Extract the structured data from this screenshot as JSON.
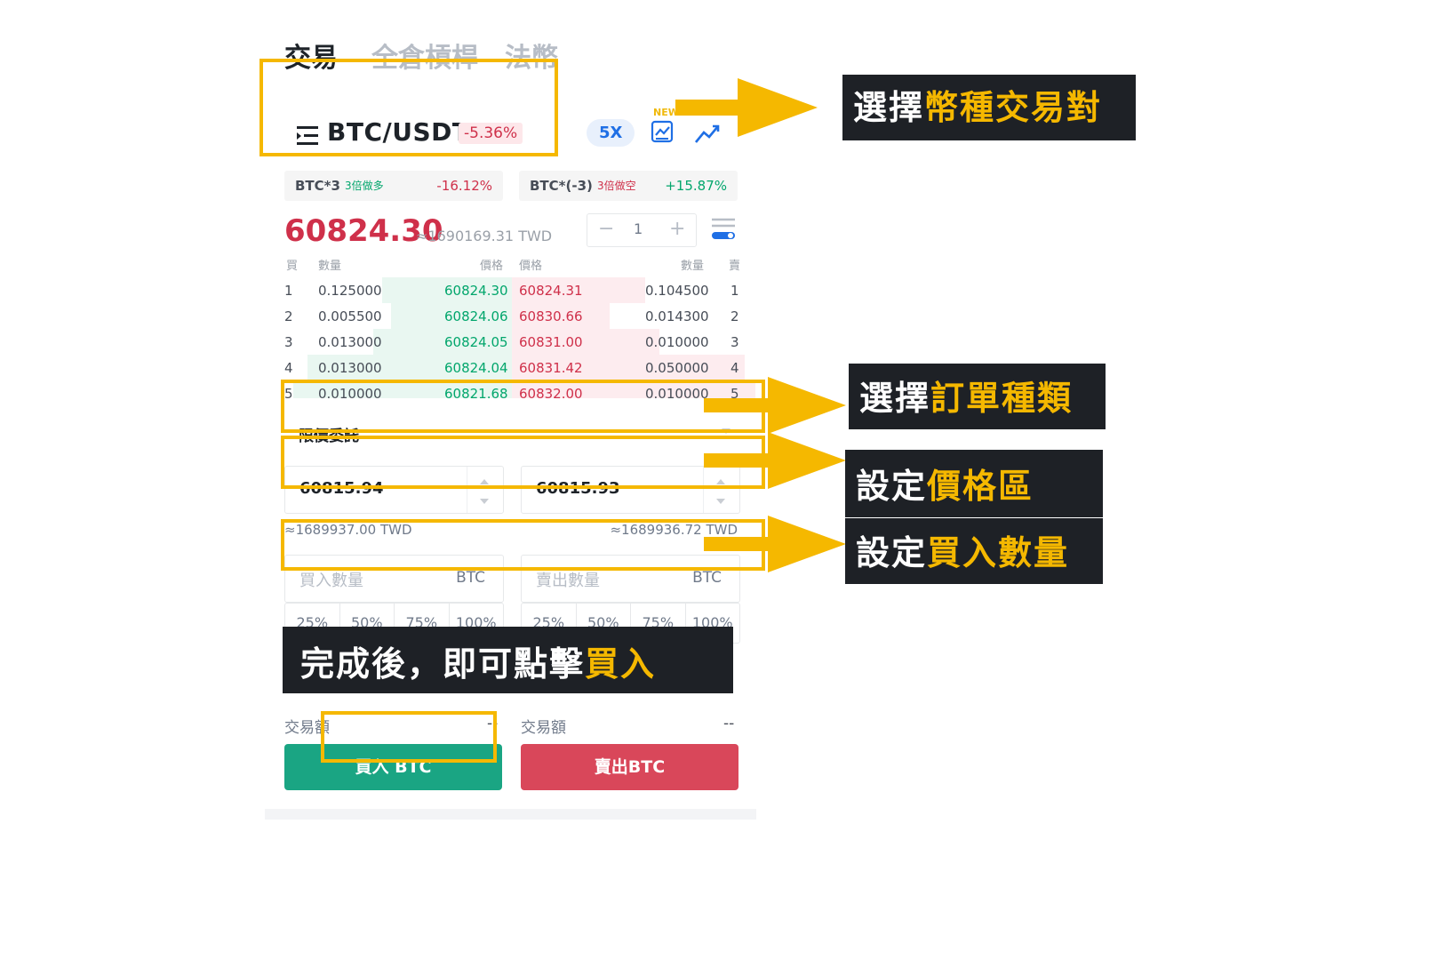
{
  "tabs": [
    "交易",
    "全倉槓桿",
    "法幣"
  ],
  "pair": {
    "name": "BTC/USDT",
    "change": "-5.36%",
    "leverage": "5X",
    "new_tag": "NEW"
  },
  "leveraged_tokens": [
    {
      "name": "BTC*3",
      "tag": "3倍做多",
      "change": "-16.12%"
    },
    {
      "name": "BTC*(-3)",
      "tag": "3倍做空",
      "change": "+15.87%"
    }
  ],
  "price": {
    "last": "60824.30",
    "twd": "≈1690169.31 TWD",
    "step_value": "1"
  },
  "orderbook": {
    "headers": {
      "buy": "買",
      "qty_left": "數量",
      "price_left": "價格",
      "price_right": "價格",
      "qty_right": "數量",
      "sell": "賣"
    },
    "rows": [
      {
        "i": "1",
        "bq": "0.125000",
        "bp": "60824.30",
        "sp": "60824.31",
        "sq": "0.104500",
        "j": "1"
      },
      {
        "i": "2",
        "bq": "0.005500",
        "bp": "60824.06",
        "sp": "60830.66",
        "sq": "0.014300",
        "j": "2"
      },
      {
        "i": "3",
        "bq": "0.013000",
        "bp": "60824.05",
        "sp": "60831.00",
        "sq": "0.010000",
        "j": "3"
      },
      {
        "i": "4",
        "bq": "0.013000",
        "bp": "60824.04",
        "sp": "60831.42",
        "sq": "0.050000",
        "j": "4"
      },
      {
        "i": "5",
        "bq": "0.010000",
        "bp": "60821.68",
        "sp": "60832.00",
        "sq": "0.010000",
        "j": "5"
      }
    ]
  },
  "form": {
    "order_type": "限價委託",
    "buy_price": "60815.94",
    "sell_price": "60815.93",
    "buy_twd": "≈1689937.00 TWD",
    "sell_twd": "≈1689936.72 TWD",
    "buy_qty_placeholder": "買入數量",
    "sell_qty_placeholder": "賣出數量",
    "unit": "BTC",
    "percents": [
      "25%",
      "50%",
      "75%",
      "100%"
    ],
    "volume_label": "交易額",
    "volume_value": "--"
  },
  "buttons": {
    "buy": "買入 BTC",
    "sell": "賣出BTC"
  },
  "annotations": {
    "pair": {
      "white": "選擇",
      "yellow": "幣種交易對"
    },
    "order_type": {
      "white": "選擇",
      "yellow": "訂單種類"
    },
    "price": {
      "white": "設定",
      "yellow": "價格區"
    },
    "qty": {
      "white": "設定",
      "yellow": "買入數量"
    },
    "done": {
      "white": "完成後，即可點擊",
      "yellow": "買入"
    }
  },
  "colors": {
    "accent": "#f5b800",
    "buy": "#1aa583",
    "sell": "#d9475a",
    "down": "#cf304a",
    "up": "#02a66c"
  }
}
